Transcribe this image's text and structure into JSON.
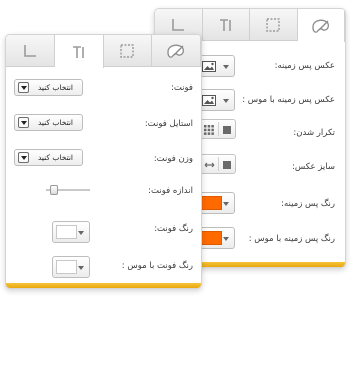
{
  "back_panel": {
    "tabs": [
      {
        "name": "tab-layout",
        "active": false
      },
      {
        "name": "tab-typography",
        "active": false
      },
      {
        "name": "tab-border",
        "active": false
      },
      {
        "name": "tab-color",
        "active": true
      }
    ],
    "rows": {
      "background_image": "عکس پس زمینه:",
      "background_image_hover": "عکس پس زمینه با موس :",
      "repeat": "تکرار شدن:",
      "image_size": "سایز عکس:",
      "background_color": "رنگ پس زمینه:",
      "background_color_hover": "رنگ پس زمینه با موس :"
    },
    "swatch_color": "#ff6a00"
  },
  "front_panel": {
    "tabs": [
      {
        "name": "tab-layout",
        "active": false
      },
      {
        "name": "tab-typography",
        "active": true
      },
      {
        "name": "tab-border",
        "active": false
      },
      {
        "name": "tab-color",
        "active": false
      }
    ],
    "font_label": "فونت:",
    "font_value": "انتخاب کنید",
    "font_style_label": "استایل فونت:",
    "font_style_value": "انتخاب کنید",
    "font_weight_label": "وزن فونت:",
    "font_weight_value": "انتخاب کنید",
    "font_size_label": "اندازه فونت:",
    "font_size_level": 0.1,
    "font_color_label": "رنگ فونت:",
    "font_color_hover_label": "رنگ فونت با موس :",
    "font_swatch_color": "#ffffff"
  },
  "accent_color": "#f0b42a"
}
